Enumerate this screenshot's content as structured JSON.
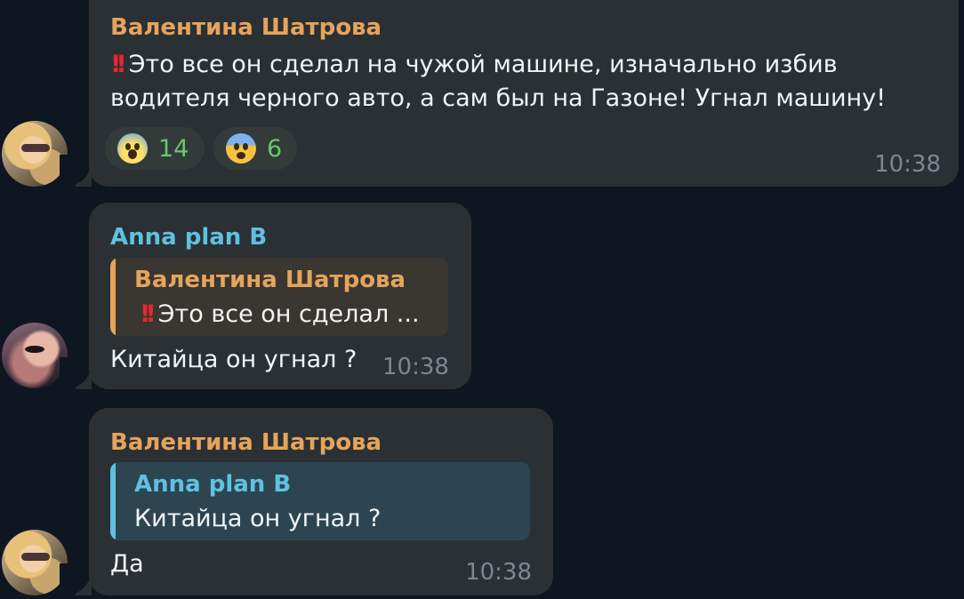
{
  "messages": [
    {
      "author": "Валентина Шатрова",
      "prefix_icon": "double-exclamation-icon",
      "prefix_glyph": "!!",
      "text_line1": "Это все он сделал на чужой машине, изначально избив",
      "text_line2": "водителя черного авто, а сам был на Газоне! Угнал машину!",
      "reactions": [
        {
          "emoji": "face-screaming-in-fear-icon",
          "count": "14"
        },
        {
          "emoji": "fearful-face-icon",
          "count": "6"
        }
      ],
      "time": "10:38"
    },
    {
      "author": "Anna plan B",
      "reply": {
        "author": "Валентина Шатрова",
        "prefix_glyph": "!!",
        "text": "Это все он сделал ..."
      },
      "text": "Китайца он угнал ?",
      "time": "10:38"
    },
    {
      "author": "Валентина Шатрова",
      "reply": {
        "author": "Anna plan B",
        "text": "Китайца он угнал ?"
      },
      "text": "Да",
      "time": "10:38"
    }
  ],
  "colors": {
    "background": "#0e1621",
    "bubble": "#2b3034",
    "orange_name": "#e5a45c",
    "blue_name": "#5fc1e0",
    "reaction_count": "#6cc46c"
  }
}
